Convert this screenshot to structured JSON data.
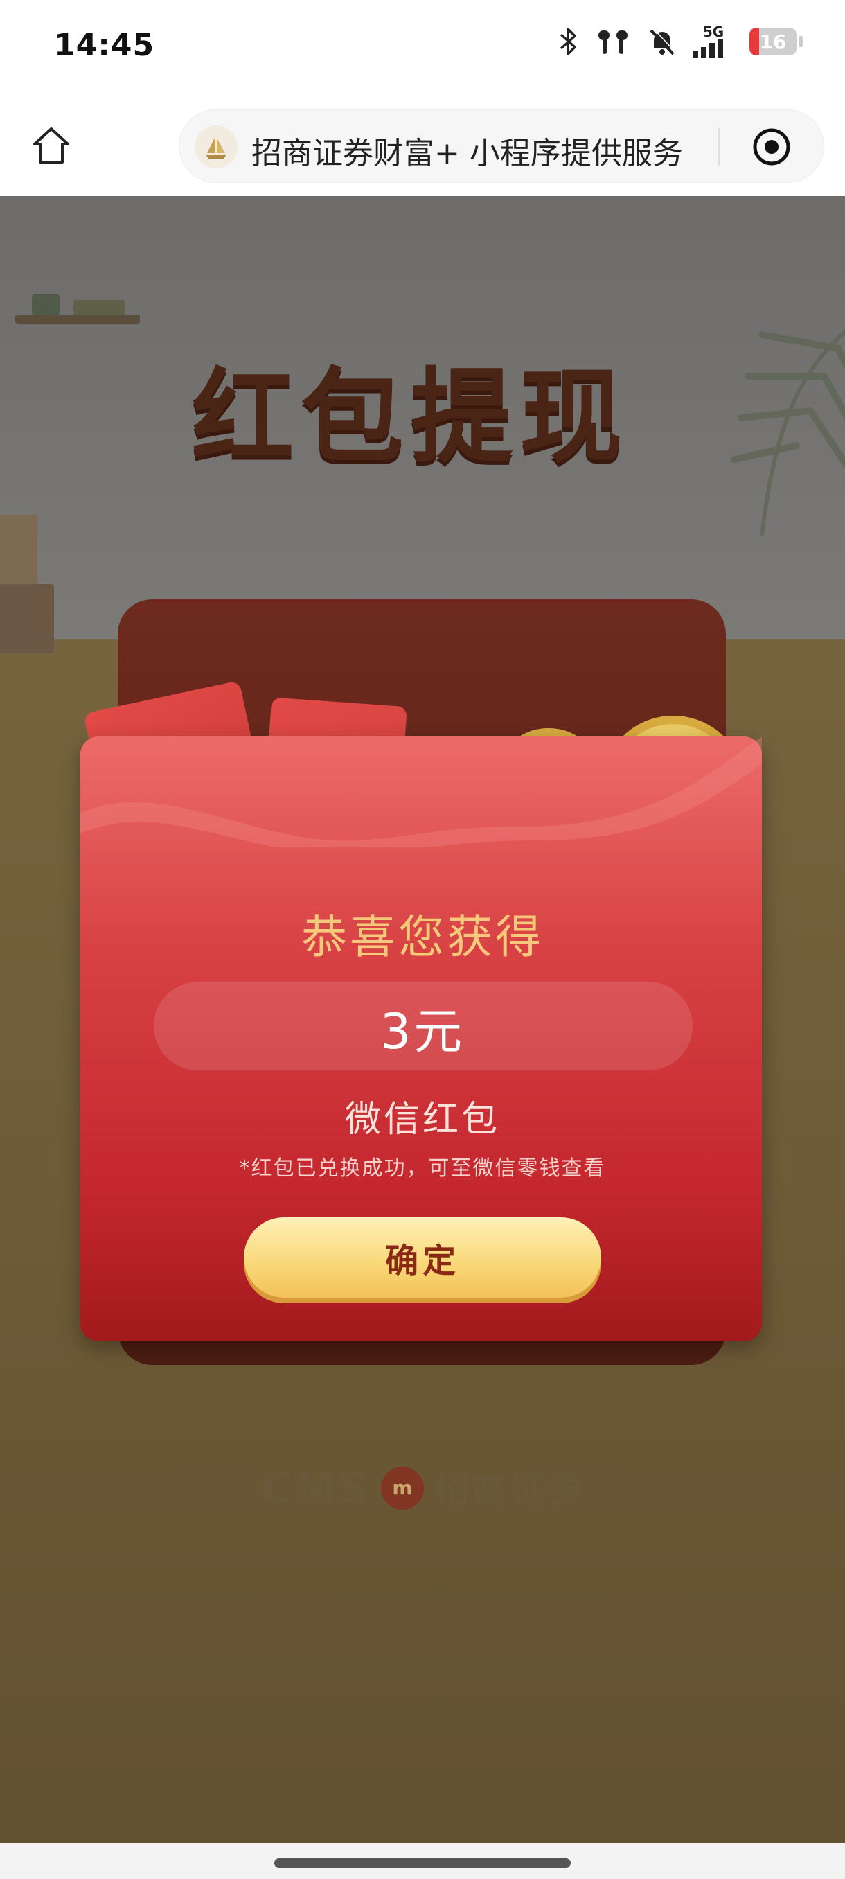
{
  "status_bar": {
    "time": "14:45",
    "network": "5G",
    "battery": "16",
    "icons": [
      "bluetooth-icon",
      "earbuds-icon",
      "mute-bell-icon",
      "signal-icon",
      "battery-icon"
    ]
  },
  "nav": {
    "mini_program_title": "招商证券财富+ 小程序提供服务",
    "icons": [
      "home-icon",
      "mini-program-logo",
      "target-icon"
    ]
  },
  "page": {
    "heading": "红包提现",
    "congrats": "恭喜您获得",
    "amount": "3元",
    "reward_type": "微信红包",
    "note": "*红包已兑换成功，可至微信零钱查看",
    "confirm_label": "确定",
    "packet_symbol": "¥"
  },
  "footer_logo": {
    "latin": "CMS",
    "chinese": "招商证券"
  },
  "colors": {
    "envelope_red": "#d84244",
    "gold_text": "#f6c97b",
    "button_gold": "#f9d776",
    "button_text": "#8a2a16",
    "heading_brown": "#4a2415"
  }
}
